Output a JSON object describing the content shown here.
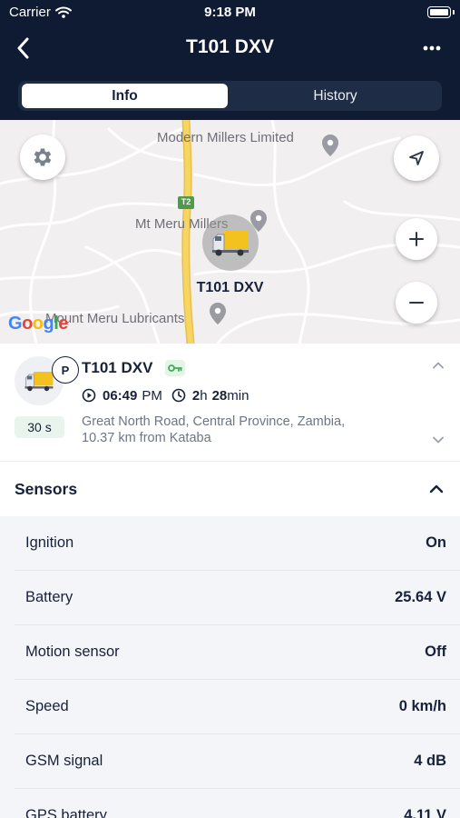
{
  "status_bar": {
    "carrier": "Carrier",
    "time": "9:18 PM"
  },
  "nav": {
    "title": "T101 DXV",
    "back_icon": "chevron-left-icon",
    "more_icon": "ellipsis-icon"
  },
  "tabs": [
    {
      "label": "Info",
      "active": true
    },
    {
      "label": "History",
      "active": false
    }
  ],
  "map": {
    "labels": {
      "poi_1": "Modern Millers Limited",
      "poi_2": "Mt Meru Millers",
      "poi_3": "Mount Meru Lubricants",
      "road_shield": "T2"
    },
    "marker_label": "T101 DXV",
    "logo": "Google",
    "controls": [
      "gear-icon",
      "locate-icon",
      "zoom-in-icon",
      "zoom-out-icon"
    ]
  },
  "unit": {
    "name": "T101 DXV",
    "status_letter": "P",
    "update_interval": "30 s",
    "time": "06:49",
    "time_suffix": "PM",
    "duration_hours": "2",
    "duration_hours_unit": "h",
    "duration_minutes": "28",
    "duration_minutes_unit": "min",
    "address_line1": "Great North Road, Central Province, Zambia,",
    "address_line2": "10.37 km from Kataba"
  },
  "sensors": {
    "title": "Sensors",
    "items": [
      {
        "name": "Ignition",
        "value": "On"
      },
      {
        "name": "Battery",
        "value": "25.64 V"
      },
      {
        "name": "Motion sensor",
        "value": "Off"
      },
      {
        "name": "Speed",
        "value": "0 km/h"
      },
      {
        "name": "GSM signal",
        "value": "4 dB"
      },
      {
        "name": "GPS battery",
        "value": "4.11 V"
      }
    ]
  },
  "colors": {
    "header_bg": "#0e1b33",
    "road_yellow": "#f4cf4e",
    "map_bg": "#f1eff0",
    "badge_green": "#e8f4ec",
    "key_green": "#3fae5b"
  }
}
